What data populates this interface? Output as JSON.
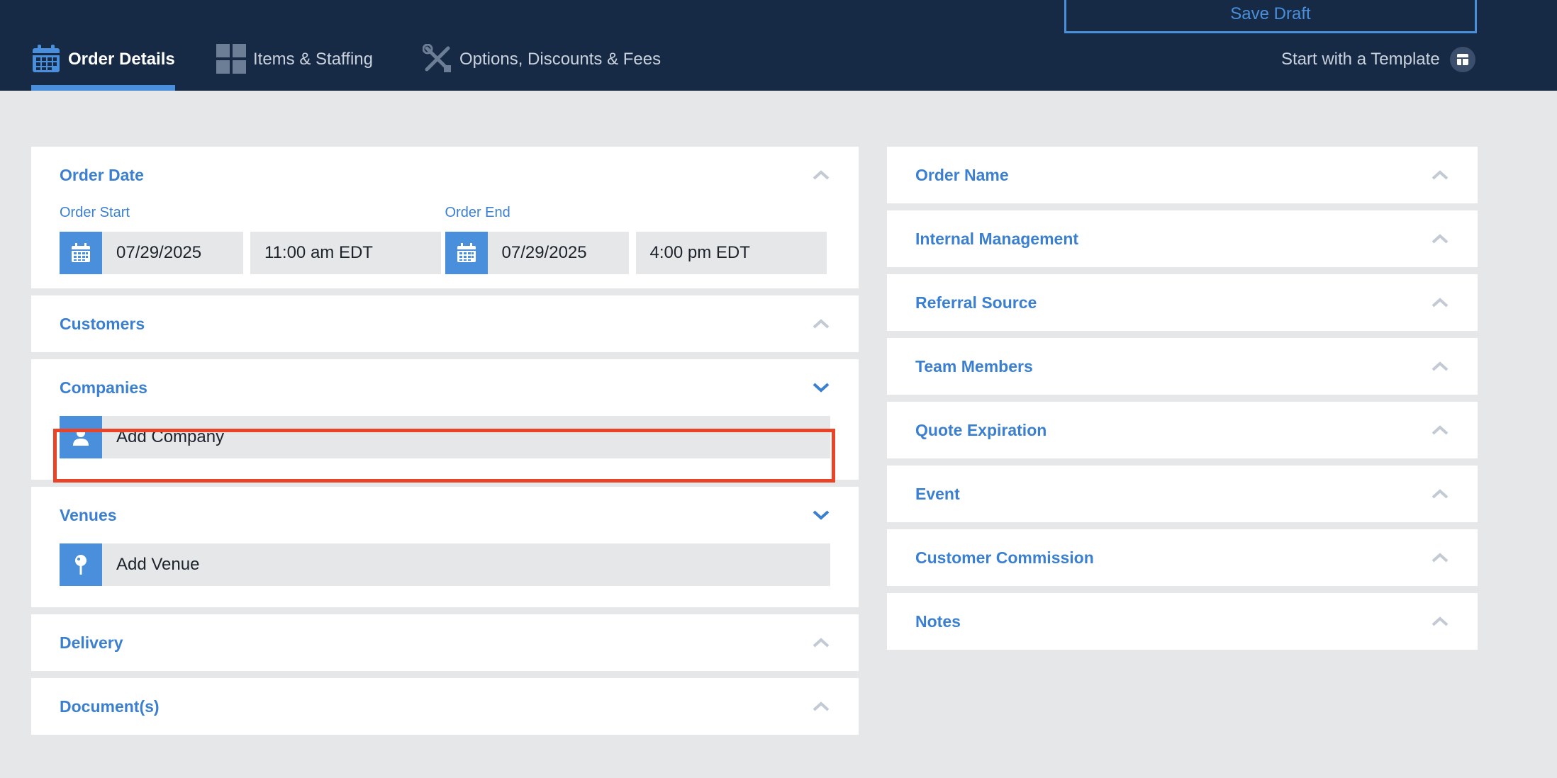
{
  "header": {
    "save_draft_label": "Save Draft",
    "tabs": [
      {
        "label": "Order Details",
        "icon": "calendar-icon",
        "active": true
      },
      {
        "label": "Items & Staffing",
        "icon": "grid-icon",
        "active": false
      },
      {
        "label": "Options, Discounts & Fees",
        "icon": "tools-icon",
        "active": false
      }
    ],
    "template_label": "Start with a Template"
  },
  "left_panels": {
    "order_date": {
      "title": "Order Date",
      "start_label": "Order Start",
      "start_date": "07/29/2025",
      "start_time": "11:00 am EDT",
      "end_label": "Order End",
      "end_date": "07/29/2025",
      "end_time": "4:00 pm EDT"
    },
    "customers": {
      "title": "Customers"
    },
    "companies": {
      "title": "Companies",
      "add_label": "Add Company"
    },
    "venues": {
      "title": "Venues",
      "add_label": "Add Venue"
    },
    "delivery": {
      "title": "Delivery"
    },
    "documents": {
      "title": "Document(s)"
    }
  },
  "right_panels": [
    {
      "title": "Order Name"
    },
    {
      "title": "Internal Management"
    },
    {
      "title": "Referral Source"
    },
    {
      "title": "Team Members"
    },
    {
      "title": "Quote Expiration"
    },
    {
      "title": "Event"
    },
    {
      "title": "Customer Commission"
    },
    {
      "title": "Notes"
    }
  ],
  "colors": {
    "header_bg": "#172a45",
    "accent": "#4a8fdb",
    "title_blue": "#3b7fd1",
    "highlight": "#e8442a",
    "page_bg": "#e6e7e9"
  }
}
